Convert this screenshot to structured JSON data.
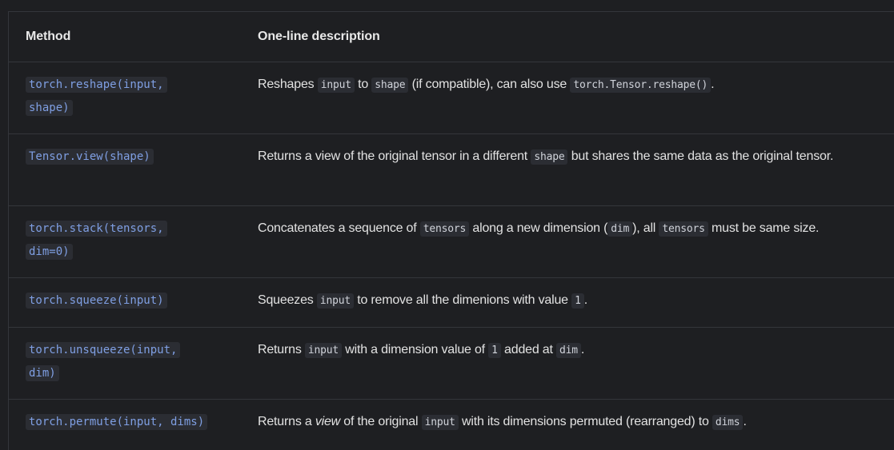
{
  "table": {
    "headers": {
      "method": "Method",
      "description": "One-line description"
    },
    "rows": [
      {
        "method": "torch.reshape(input, shape)",
        "desc": {
          "t0": "Reshapes ",
          "c0": "input",
          "t1": " to ",
          "c1": "shape",
          "t2": " (if compatible), can also use ",
          "c2": "torch.Tensor.reshape()",
          "t3": "."
        }
      },
      {
        "method": "Tensor.view(shape)",
        "desc": {
          "t0": "Returns a view of the original tensor in a different ",
          "c0": "shape",
          "t1": " but shares the same data as the original tensor."
        }
      },
      {
        "method": "torch.stack(tensors, dim=0)",
        "desc": {
          "t0": "Concatenates a sequence of ",
          "c0": "tensors",
          "t1": " along a new dimension (",
          "c1": "dim",
          "t2": "), all ",
          "c2": "tensors",
          "t3": " must be same size."
        }
      },
      {
        "method": "torch.squeeze(input)",
        "desc": {
          "t0": "Squeezes ",
          "c0": "input",
          "t1": " to remove all the dimenions with value ",
          "c1": "1",
          "t2": "."
        }
      },
      {
        "method": "torch.unsqueeze(input, dim)",
        "desc": {
          "t0": "Returns ",
          "c0": "input",
          "t1": " with a dimension value of ",
          "c1": "1",
          "t2": " added at ",
          "c2": "dim",
          "t3": "."
        }
      },
      {
        "method": "torch.permute(input, dims)",
        "desc": {
          "t0": "Returns a ",
          "em0": "view",
          "t1": " of the original ",
          "c0": "input",
          "t2": " with its dimensions permuted (rearranged) to ",
          "c1": "dims",
          "t3": "."
        }
      }
    ]
  }
}
